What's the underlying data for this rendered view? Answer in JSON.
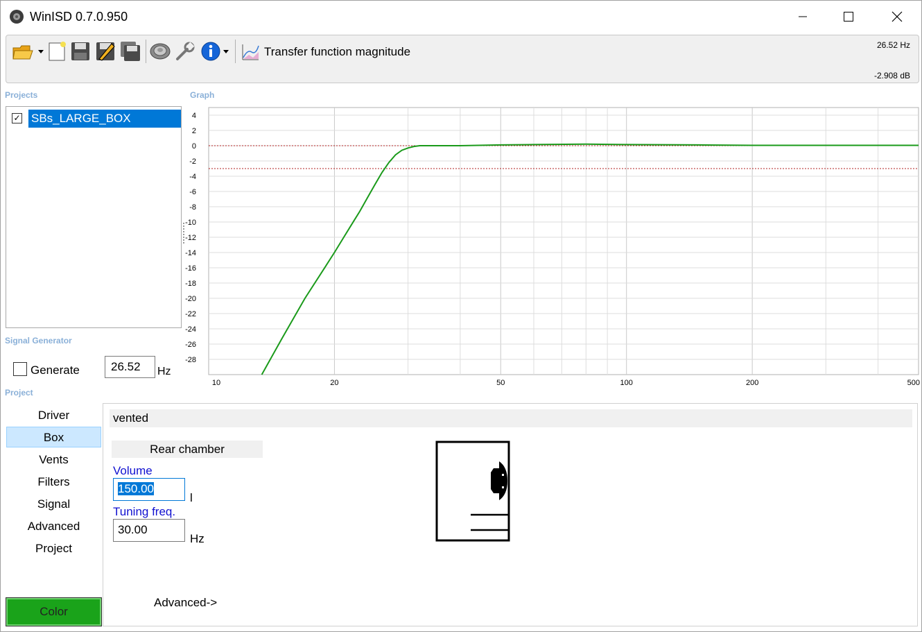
{
  "window": {
    "title": "WinISD 0.7.0.950"
  },
  "toolbar": {
    "icons": [
      "open-folder-icon",
      "new-document-icon",
      "save-icon",
      "save-edit-icon",
      "save-all-icon",
      "speaker-driver-icon",
      "wrench-icon",
      "info-icon"
    ],
    "graph_type_label": "Transfer function magnitude",
    "cursor_freq": "26.52 Hz",
    "cursor_level": "-2.908 dB"
  },
  "projects": {
    "label": "Projects",
    "items": [
      {
        "name": "SBs_LARGE_BOX",
        "checked": true
      }
    ]
  },
  "graph": {
    "label": "Graph"
  },
  "signal_generator": {
    "label": "Signal Generator",
    "generate_label": "Generate",
    "generate_checked": false,
    "frequency": "26.52",
    "unit": "Hz"
  },
  "project_nav": {
    "label": "Project",
    "items": [
      "Driver",
      "Box",
      "Vents",
      "Filters",
      "Signal",
      "Advanced",
      "Project"
    ],
    "active": "Box",
    "color_button": "Color",
    "color_value": "#1aa31a"
  },
  "box_panel": {
    "box_type": "vented",
    "section_header": "Rear chamber",
    "volume_label": "Volume",
    "volume_value": "150.00",
    "volume_unit": "l",
    "tuning_label": "Tuning freq.",
    "tuning_value": "30.00",
    "tuning_unit": "Hz",
    "advanced_link": "Advanced->"
  },
  "chart_data": {
    "type": "line",
    "title": "",
    "xlabel": "",
    "ylabel": "",
    "x_scale": "log",
    "xlim": [
      10,
      500
    ],
    "ylim": [
      -30,
      5
    ],
    "x_ticks": [
      10,
      20,
      50,
      100,
      200,
      500
    ],
    "y_ticks": [
      4,
      2,
      0,
      -2,
      -4,
      -6,
      -8,
      -10,
      -12,
      -14,
      -16,
      -18,
      -20,
      -22,
      -24,
      -26,
      -28
    ],
    "reference_lines_db": [
      0,
      -3
    ],
    "grid": true,
    "series": [
      {
        "color": "#1a9a1a",
        "x": [
          13.4,
          15,
          17,
          19,
          20,
          21,
          22,
          23,
          24,
          25,
          26,
          27,
          28,
          29,
          30,
          31,
          32,
          35,
          40,
          50,
          60,
          80,
          100,
          150,
          200,
          300,
          500
        ],
        "y": [
          -30,
          -25.2,
          -20.0,
          -15.9,
          -14.0,
          -12.1,
          -10.3,
          -8.6,
          -6.8,
          -5.1,
          -3.5,
          -2.2,
          -1.2,
          -0.6,
          -0.3,
          -0.1,
          0.0,
          0.0,
          0.0,
          0.1,
          0.15,
          0.2,
          0.15,
          0.1,
          0.05,
          0.05,
          0.05
        ]
      }
    ]
  }
}
